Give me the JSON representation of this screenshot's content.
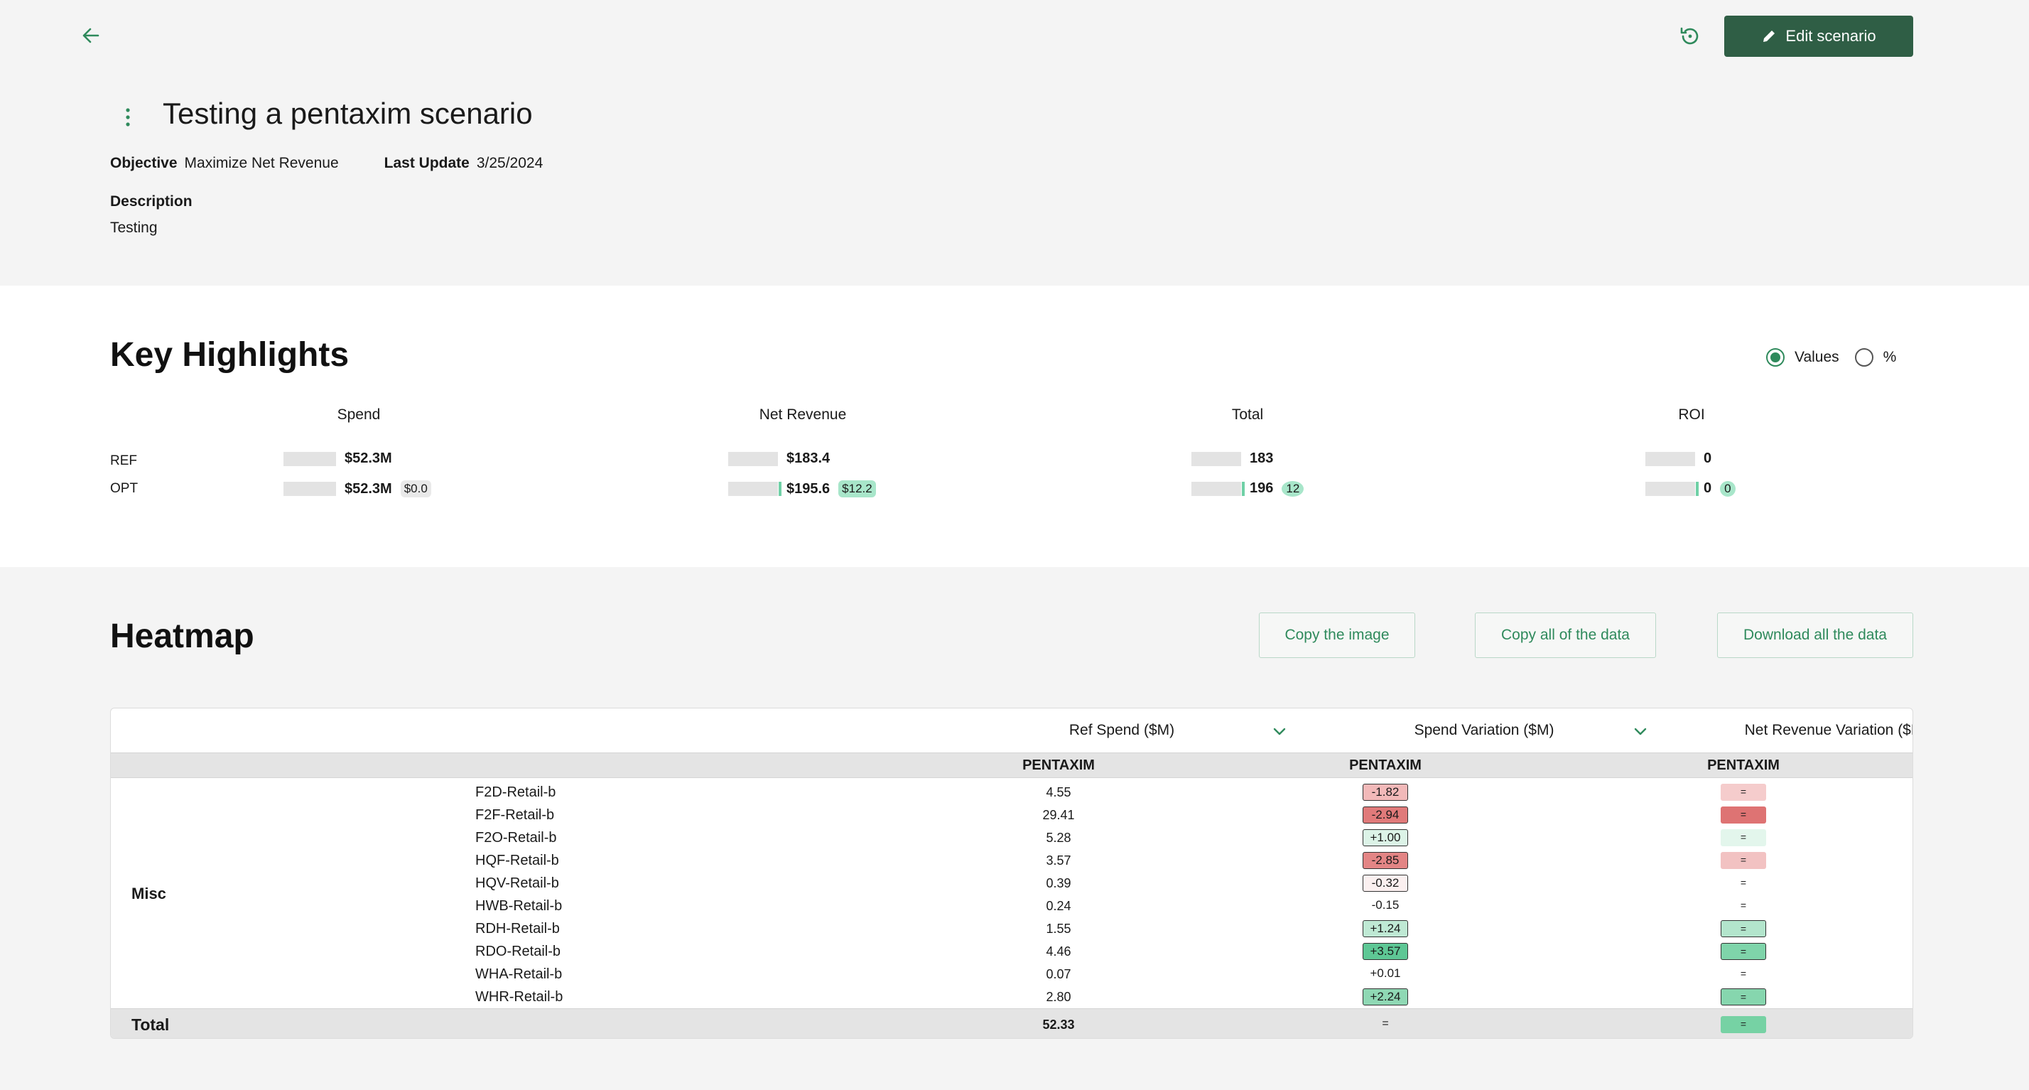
{
  "header": {
    "title": "Testing a pentaxim scenario",
    "edit_label": "Edit scenario",
    "objective_label": "Objective",
    "objective_value": "Maximize Net Revenue",
    "last_update_label": "Last Update",
    "last_update_value": "3/25/2024",
    "description_label": "Description",
    "description_value": "Testing",
    "icons": [
      "arrow-left-icon",
      "history-icon",
      "pencil-icon",
      "kebab-icon"
    ]
  },
  "highlights": {
    "title": "Key Highlights",
    "toggle": {
      "options": [
        "Values",
        "%"
      ],
      "selected": "Values"
    },
    "row_labels": [
      "REF",
      "OPT"
    ],
    "kpis": [
      {
        "name": "Spend",
        "ref": "$52.3M",
        "opt": "$52.3M",
        "delta": "$0.0"
      },
      {
        "name": "Net Revenue",
        "ref": "$183.4",
        "opt": "$195.6",
        "delta": "$12.2"
      },
      {
        "name": "Total",
        "ref": "183",
        "opt": "196",
        "delta": "12"
      },
      {
        "name": "ROI",
        "ref": "0",
        "opt": "0",
        "delta": "0"
      }
    ]
  },
  "heatmap": {
    "title": "Heatmap",
    "buttons": [
      "Copy the image",
      "Copy all of the data",
      "Download all the data"
    ],
    "columns": [
      "Ref Spend ($M)",
      "Spend Variation ($M)",
      "Net Revenue Variation ($M)"
    ],
    "subheader": "PENTAXIM",
    "group": "Misc",
    "rows": [
      {
        "name": "F2D-Retail-b",
        "ref": "4.55",
        "var": "-1.82",
        "var_color": "#f2b9b9",
        "rev": "=",
        "rev_color": "#f5cccc"
      },
      {
        "name": "F2F-Retail-b",
        "ref": "29.41",
        "var": "-2.94",
        "var_color": "#e07a7a",
        "rev": "=",
        "rev_color": "#de7373"
      },
      {
        "name": "F2O-Retail-b",
        "ref": "5.28",
        "var": "+1.00",
        "var_color": "#dcf3e7",
        "rev": "=",
        "rev_color": "#e3f6ec"
      },
      {
        "name": "HQF-Retail-b",
        "ref": "3.57",
        "var": "-2.85",
        "var_color": "#e38585",
        "rev": "=",
        "rev_color": "#f2c2c2"
      },
      {
        "name": "HQV-Retail-b",
        "ref": "0.39",
        "var": "-0.32",
        "var_color": "#fbf0f0",
        "rev": "=",
        "rev_color": "#ffffff"
      },
      {
        "name": "HWB-Retail-b",
        "ref": "0.24",
        "var": "-0.15",
        "var_color": "#ffffff",
        "rev": "=",
        "rev_color": "#ffffff"
      },
      {
        "name": "RDH-Retail-b",
        "ref": "1.55",
        "var": "+1.24",
        "var_color": "#bfe9d4",
        "rev": "=",
        "rev_color": "#b3e5cc"
      },
      {
        "name": "RDO-Retail-b",
        "ref": "4.46",
        "var": "+3.57",
        "var_color": "#5ec795",
        "rev": "=",
        "rev_color": "#7fd4aa"
      },
      {
        "name": "WHA-Retail-b",
        "ref": "0.07",
        "var": "+0.01",
        "var_color": "#ffffff",
        "rev": "=",
        "rev_color": "#ffffff"
      },
      {
        "name": "WHR-Retail-b",
        "ref": "2.80",
        "var": "+2.24",
        "var_color": "#8fd8b4",
        "rev": "=",
        "rev_color": "#86d6ae"
      }
    ],
    "total": {
      "label": "Total",
      "ref": "52.33",
      "var": "=",
      "rev": "=",
      "rev_color": "#76d2a4"
    }
  }
}
